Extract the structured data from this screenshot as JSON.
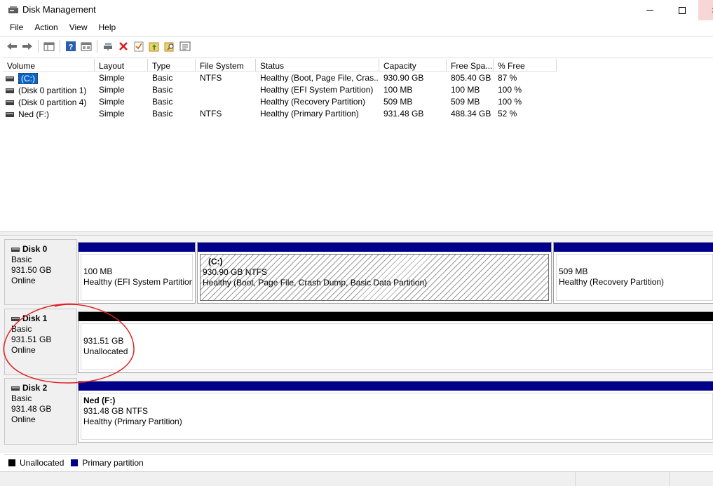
{
  "window": {
    "title": "Disk Management",
    "close_glyph": "✕"
  },
  "menu": [
    "File",
    "Action",
    "View",
    "Help"
  ],
  "toolbar": {
    "icons": [
      "back-arrow-icon",
      "forward-arrow-icon",
      "console-tree-icon",
      "help-icon",
      "properties-pane-icon",
      "connect-drive-icon",
      "delete-icon",
      "check-icon",
      "folder-up-icon",
      "search-folder-icon",
      "list-view-icon"
    ]
  },
  "volume_list": {
    "columns": [
      "Volume",
      "Layout",
      "Type",
      "File System",
      "Status",
      "Capacity",
      "Free Spa...",
      "% Free"
    ],
    "rows": [
      {
        "volume": "(C:)",
        "layout": "Simple",
        "type": "Basic",
        "fs": "NTFS",
        "status": "Healthy (Boot, Page File, Cras...",
        "capacity": "930.90 GB",
        "free": "805.40 GB",
        "pct": "87 %"
      },
      {
        "volume": "(Disk 0 partition 1)",
        "layout": "Simple",
        "type": "Basic",
        "fs": "",
        "status": "Healthy (EFI System Partition)",
        "capacity": "100 MB",
        "free": "100 MB",
        "pct": "100 %"
      },
      {
        "volume": "(Disk 0 partition 4)",
        "layout": "Simple",
        "type": "Basic",
        "fs": "",
        "status": "Healthy (Recovery Partition)",
        "capacity": "509 MB",
        "free": "509 MB",
        "pct": "100 %"
      },
      {
        "volume": "Ned (F:)",
        "layout": "Simple",
        "type": "Basic",
        "fs": "NTFS",
        "status": "Healthy (Primary Partition)",
        "capacity": "931.48 GB",
        "free": "488.34 GB",
        "pct": "52 %"
      }
    ]
  },
  "disks": [
    {
      "name": "Disk 0",
      "type": "Basic",
      "size": "931.50 GB",
      "state": "Online",
      "partitions": [
        {
          "name": "",
          "size": "100 MB",
          "status": "Healthy (EFI System Partition)"
        },
        {
          "name": "(C:)",
          "size": "930.90 GB NTFS",
          "status": "Healthy (Boot, Page File, Crash Dump, Basic Data Partition)"
        },
        {
          "name": "",
          "size": "509 MB",
          "status": "Healthy (Recovery Partition)"
        }
      ]
    },
    {
      "name": "Disk 1",
      "type": "Basic",
      "size": "931.51 GB",
      "state": "Online",
      "partitions": [
        {
          "name": "",
          "size": "931.51 GB",
          "status": "Unallocated"
        }
      ]
    },
    {
      "name": "Disk 2",
      "type": "Basic",
      "size": "931.48 GB",
      "state": "Online",
      "partitions": [
        {
          "name": "Ned  (F:)",
          "size": "931.48 GB NTFS",
          "status": "Healthy (Primary Partition)"
        }
      ]
    }
  ],
  "legend": [
    {
      "label": "Unallocated",
      "color": "#000000"
    },
    {
      "label": "Primary partition",
      "color": "#00008b"
    }
  ],
  "colors": {
    "primary_partition": "#00008b",
    "unallocated": "#000000",
    "selection": "#0a64c8",
    "annotation": "#e02020"
  }
}
